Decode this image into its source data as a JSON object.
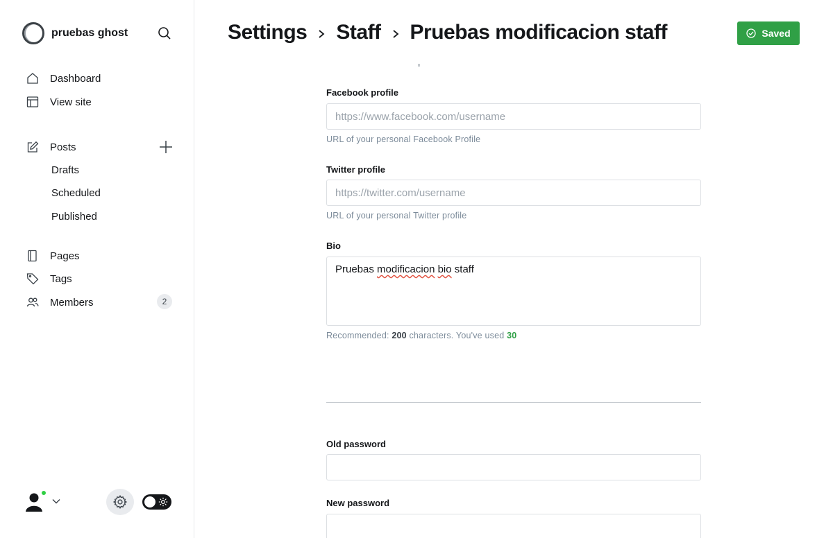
{
  "sidebar": {
    "site_name": "pruebas ghost",
    "nav": {
      "dashboard": "Dashboard",
      "view_site": "View site",
      "posts": "Posts",
      "drafts": "Drafts",
      "scheduled": "Scheduled",
      "published": "Published",
      "pages": "Pages",
      "tags": "Tags",
      "members": "Members"
    },
    "members_count": "2"
  },
  "header": {
    "breadcrumb": [
      "Settings",
      "Staff",
      "Pruebas modificacion staff"
    ],
    "saved_label": "Saved"
  },
  "form": {
    "facebook": {
      "label": "Facebook profile",
      "placeholder": "https://www.facebook.com/username",
      "value": "",
      "hint": "URL of your personal Facebook Profile"
    },
    "twitter": {
      "label": "Twitter profile",
      "placeholder": "https://twitter.com/username",
      "value": "",
      "hint": "URL of your personal Twitter profile"
    },
    "bio": {
      "label": "Bio",
      "value_words": [
        "Pruebas",
        "modificacion",
        "bio",
        "staff"
      ],
      "hint_prefix": "Recommended: ",
      "hint_max": "200",
      "hint_middle": " characters. You've used ",
      "hint_used": "30"
    },
    "old_password": {
      "label": "Old password",
      "value": ""
    },
    "new_password": {
      "label": "New password",
      "value": ""
    }
  },
  "colors": {
    "accent_green": "#30a046",
    "online_dot": "#30cf43",
    "text_dark": "#15171a",
    "hint_gray": "#7c8b9a"
  },
  "icons": {
    "search": "search-icon",
    "dashboard": "home-icon",
    "view_site": "layout-icon",
    "posts": "edit-icon",
    "add": "plus-icon",
    "pages": "page-icon",
    "tags": "tag-icon",
    "members": "members-icon",
    "settings": "gear-icon",
    "saved": "check-circle-icon",
    "theme": "sun-icon"
  }
}
